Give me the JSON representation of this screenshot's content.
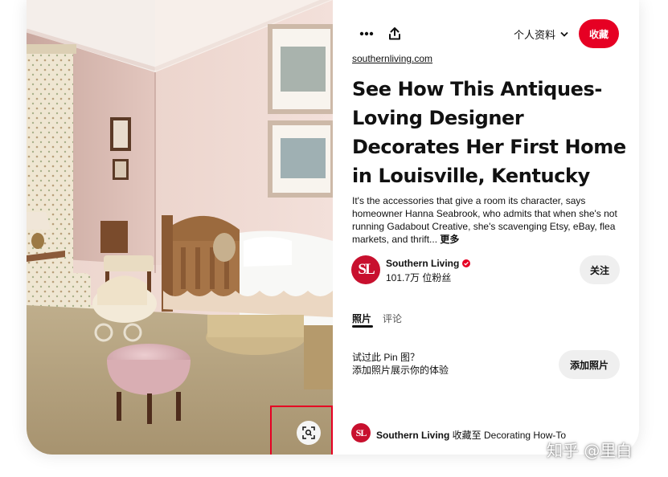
{
  "pin": {
    "source_domain": "southernliving.com",
    "title": "See How This Antiques-Loving Designer Decorates Her First Home in Louisville, Kentucky",
    "description": "It's the accessories that give a room its character, says homeowner Hanna Seabrook, who admits that when she's not running Gadabout Creative, she's scavenging Etsy, eBay, flea markets, and thrift...",
    "more_label": "更多"
  },
  "toolbar": {
    "more_icon": "ellipsis-icon",
    "share_icon": "share-icon",
    "profile_label": "个人资料",
    "save_label": "收藏"
  },
  "author": {
    "logo_text": "SL",
    "name": "Southern Living",
    "followers": "101.7万 位粉丝",
    "follow_label": "关注",
    "verified_icon": "verified-badge-icon"
  },
  "tabs": [
    {
      "label": "照片",
      "active": true
    },
    {
      "label": "评论",
      "active": false
    }
  ],
  "try_it": {
    "title": "试过此 Pin 图？",
    "subtitle": "添加照片展示你的体验",
    "button_label": "添加照片"
  },
  "saved_by": {
    "logo_text": "SL",
    "name": "Southern Living",
    "action": " 收藏至 ",
    "board": "Decorating How-To"
  },
  "visual_search": {
    "icon": "visual-search-icon"
  },
  "watermark": "知乎 @里白",
  "colors": {
    "brand_red": "#e60023",
    "sl_red": "#c8102e",
    "button_gray": "#efefef",
    "text": "#111111"
  }
}
